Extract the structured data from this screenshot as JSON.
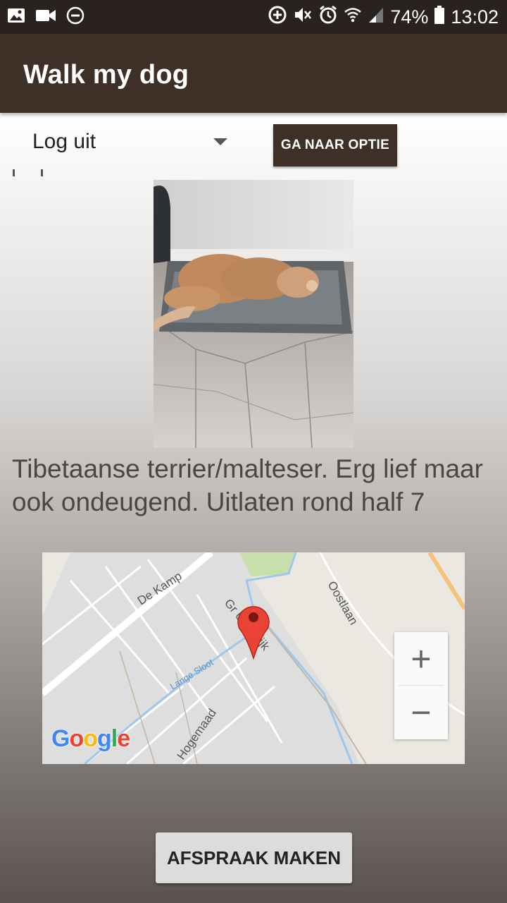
{
  "status_bar": {
    "left_icons": [
      "gallery-icon",
      "video-camera-icon",
      "do-not-disturb-icon"
    ],
    "right_icons": [
      "data-saver-icon",
      "mute-icon",
      "alarm-icon",
      "wifi-icon",
      "signal-icon",
      "battery-icon"
    ],
    "battery": "74%",
    "time": "13:02"
  },
  "app_bar": {
    "title": "Walk my dog"
  },
  "controls": {
    "spinner_value": "Log uit",
    "goto_button": "GA NAAR OPTIE"
  },
  "dog": {
    "description": "Tibetaanse terrier/malteser. Erg lief maar ook ondeugend. Uitlaten rond half 7"
  },
  "map": {
    "labels": {
      "de_kamp": "De Kamp",
      "oostlaan": "Oostlaan",
      "uitendijk": "Gr  Uitendijk",
      "lange_sloot": "Lange Sloot",
      "hogemaad": "Hogemaad"
    },
    "zoom_in": "+",
    "zoom_out": "−",
    "logo": [
      "G",
      "o",
      "o",
      "g",
      "l",
      "e"
    ],
    "logo_colors": [
      "#4285f4",
      "#ea4335",
      "#fbbc05",
      "#4285f4",
      "#34a853",
      "#ea4335"
    ]
  },
  "actions": {
    "appointment_button": "AFSPRAAK MAKEN"
  },
  "colors": {
    "app_bar": "#3e2f27",
    "status_bar": "#2a221e",
    "marker": "#ea4335"
  }
}
